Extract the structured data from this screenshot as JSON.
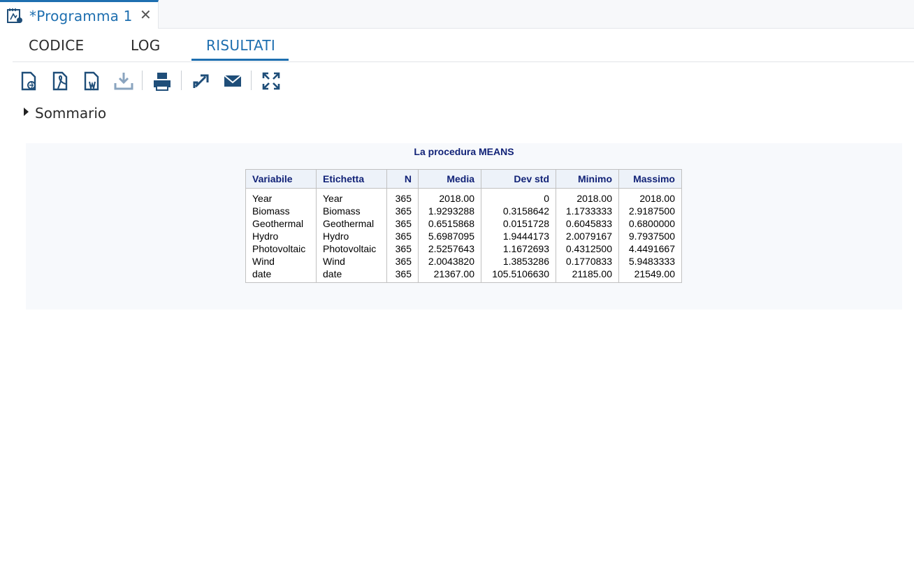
{
  "tab": {
    "title": "*Programma 1",
    "close_symbol": "✕"
  },
  "subtabs": [
    "CODICE",
    "LOG",
    "RISULTATI"
  ],
  "active_subtab": "RISULTATI",
  "toolbar": {
    "buttons": [
      "download-html-icon",
      "download-pdf-icon",
      "download-word-icon",
      "download-icon",
      "print-icon",
      "open-new-window-icon",
      "email-icon",
      "fullscreen-icon"
    ]
  },
  "summary": {
    "label": "Sommario"
  },
  "results": {
    "title": "La procedura MEANS",
    "columns": [
      "Variabile",
      "Etichetta",
      "N",
      "Media",
      "Dev std",
      "Minimo",
      "Massimo"
    ],
    "rows": [
      [
        "Year",
        "Year",
        "365",
        "2018.00",
        "0",
        "2018.00",
        "2018.00"
      ],
      [
        "Biomass",
        "Biomass",
        "365",
        "1.9293288",
        "0.3158642",
        "1.1733333",
        "2.9187500"
      ],
      [
        "Geothermal",
        "Geothermal",
        "365",
        "0.6515868",
        "0.0151728",
        "0.6045833",
        "0.6800000"
      ],
      [
        "Hydro",
        "Hydro",
        "365",
        "5.6987095",
        "1.9444173",
        "2.0079167",
        "9.7937500"
      ],
      [
        "Photovoltaic",
        "Photovoltaic",
        "365",
        "2.5257643",
        "1.1672693",
        "0.4312500",
        "4.4491667"
      ],
      [
        "Wind",
        "Wind",
        "365",
        "2.0043820",
        "1.3853286",
        "0.1770833",
        "5.9483333"
      ],
      [
        "date",
        "date",
        "365",
        "21367.00",
        "105.5106630",
        "21185.00",
        "21549.00"
      ]
    ]
  },
  "colors": {
    "accent": "#1e6fb0",
    "title": "#112277",
    "icon": "#1f4e79"
  }
}
